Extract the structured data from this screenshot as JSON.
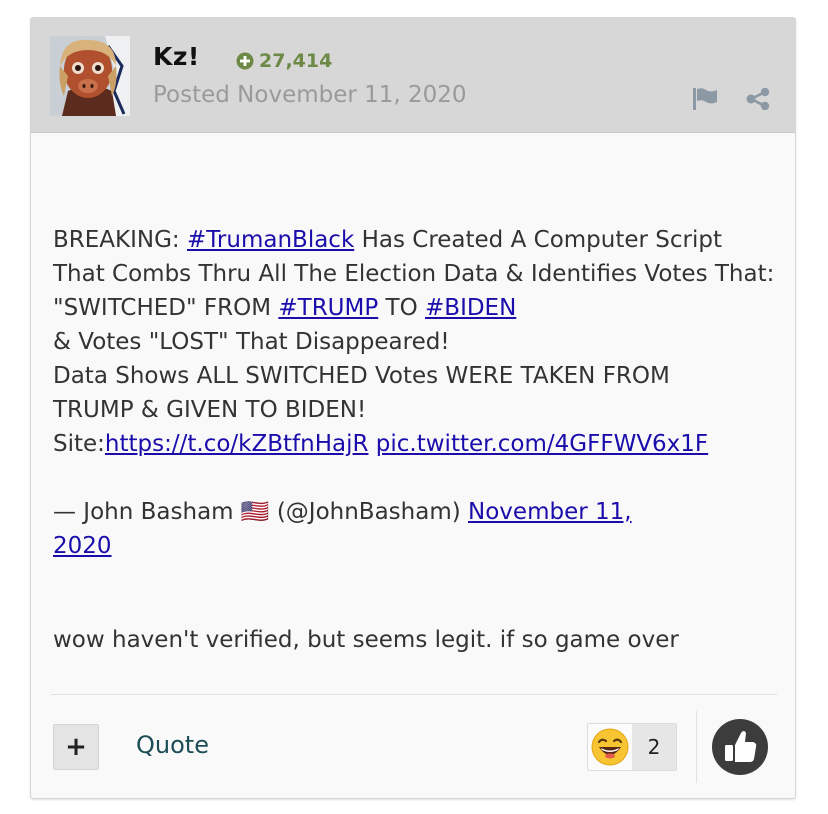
{
  "post": {
    "author": "Kz!",
    "reputation": "27,414",
    "posted": "Posted November 11, 2020",
    "tweet": {
      "l1_pre": "BREAKING: ",
      "l1_tag": "#TrumanBlack",
      "l1_post": " Has Created A Computer Script",
      "l2": "That Combs Thru All The Election Data & Identifies Votes That:",
      "l3_pre": "\"SWITCHED\" FROM ",
      "l3_tag1": "#TRUMP",
      "l3_mid": " TO ",
      "l3_tag2": "#BIDEN",
      "l4": "& Votes \"LOST\" That Disappeared!",
      "l5": "Data Shows ALL SWITCHED Votes WERE TAKEN FROM",
      "l6": "TRUMP & GIVEN TO BIDEN!",
      "l7_pre": "Site:",
      "l7_link": "https://t.co/kZBtfnHajR",
      "l7_pic": "pic.twitter.com/4GFFWV6x1F",
      "attr_pre": "— John Basham 🇺🇸 (@JohnBasham) ",
      "attr_date1": "November 11,",
      "attr_date2": "2020"
    },
    "comment": "wow haven't verified, but seems legit. if so game over"
  },
  "footer": {
    "plus_label": "+",
    "quote_label": "Quote",
    "reaction_count": "2",
    "reaction_icon": "laughing-emoji-icon",
    "like_icon": "thumbs-up-icon"
  },
  "colors": {
    "header_bg": "#d7d7d7",
    "reputation": "#6c8a45",
    "link": "#1a0dab",
    "quote": "#1c4d57"
  }
}
